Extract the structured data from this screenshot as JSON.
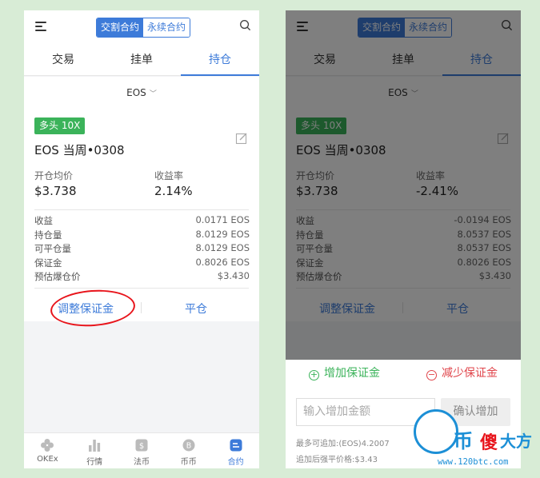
{
  "header": {
    "seg_delivery": "交割合约",
    "seg_perpetual": "永续合约"
  },
  "tabs": [
    "交易",
    "挂单",
    "持仓"
  ],
  "coin_selector": "EOS",
  "colors": {
    "accent": "#3d7bd9",
    "long_green": "#3bb35a",
    "reduce_red": "#e0454b",
    "annotation_red": "#e8141b"
  },
  "screen1": {
    "badge": "多头 10X",
    "contract": "EOS 当周•0308",
    "avg_open_label": "开仓均价",
    "avg_open_value": "$3.738",
    "yield_label": "收益率",
    "yield_value": "2.14%",
    "rows": [
      {
        "label": "收益",
        "value": "0.0171 EOS"
      },
      {
        "label": "持仓量",
        "value": "8.0129 EOS"
      },
      {
        "label": "可平仓量",
        "value": "8.0129 EOS"
      },
      {
        "label": "保证金",
        "value": "0.8026 EOS"
      },
      {
        "label": "预估爆仓价",
        "value": "$3.430"
      }
    ],
    "adjust_margin": "调整保证金",
    "close_position": "平仓"
  },
  "screen2": {
    "badge": "多头 10X",
    "contract": "EOS 当周•0308",
    "avg_open_label": "开仓均价",
    "avg_open_value": "$3.738",
    "yield_label": "收益率",
    "yield_value": "-2.41%",
    "rows": [
      {
        "label": "收益",
        "value": "-0.0194 EOS"
      },
      {
        "label": "持仓量",
        "value": "8.0537 EOS"
      },
      {
        "label": "可平仓量",
        "value": "8.0537 EOS"
      },
      {
        "label": "保证金",
        "value": "0.8026 EOS"
      },
      {
        "label": "预估爆仓价",
        "value": "$3.430"
      }
    ],
    "adjust_margin": "调整保证金",
    "close_position": "平仓"
  },
  "margin_sheet": {
    "add_tab": "增加保证金",
    "reduce_tab": "减少保证金",
    "input_placeholder": "输入增加金额",
    "confirm_button": "确认增加",
    "max_add": "最多可追加:(EOS)4.2007",
    "liq_price_after": "追加后强平价格:$3.43"
  },
  "bottom_nav": [
    "OKEx",
    "行情",
    "法币",
    "币币",
    "合约"
  ],
  "watermark": {
    "c1": "币",
    "c2": "傻",
    "c3": "大方",
    "url": "www.120btc.com"
  }
}
